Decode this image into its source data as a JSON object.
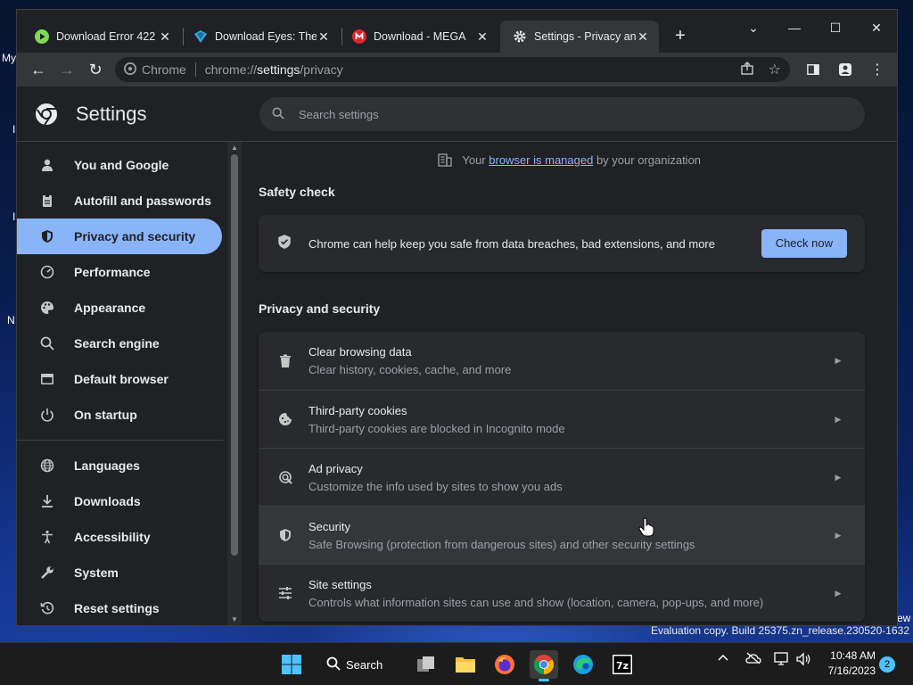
{
  "desktop": {
    "fragments": [
      "My",
      "I",
      "I",
      "N",
      "ew"
    ]
  },
  "tabs": [
    {
      "title": "Download Error 422 -",
      "icon": "play-icon",
      "color": "#7ed957"
    },
    {
      "title": "Download Eyes: The H",
      "icon": "eyes-logo-icon",
      "color": "#2ba8e0"
    },
    {
      "title": "Download - MEGA",
      "icon": "mega-icon",
      "color": "#d9272e"
    },
    {
      "title": "Settings - Privacy and",
      "icon": "gear-icon",
      "color": "#e8eaed"
    }
  ],
  "toolbar": {
    "omnibox_label": "Chrome",
    "url_prefix": "chrome://",
    "url_host": "settings",
    "url_path": "/privacy"
  },
  "settings": {
    "title": "Settings",
    "search_placeholder": "Search settings",
    "nav": [
      {
        "label": "You and Google",
        "icon": "person-icon"
      },
      {
        "label": "Autofill and passwords",
        "icon": "clipboard-icon"
      },
      {
        "label": "Privacy and security",
        "icon": "shield-icon",
        "active": true
      },
      {
        "label": "Performance",
        "icon": "speedometer-icon"
      },
      {
        "label": "Appearance",
        "icon": "palette-icon"
      },
      {
        "label": "Search engine",
        "icon": "search-icon"
      },
      {
        "label": "Default browser",
        "icon": "browser-icon"
      },
      {
        "label": "On startup",
        "icon": "power-icon"
      },
      {
        "label": "Languages",
        "icon": "globe-icon"
      },
      {
        "label": "Downloads",
        "icon": "download-icon"
      },
      {
        "label": "Accessibility",
        "icon": "accessibility-icon"
      },
      {
        "label": "System",
        "icon": "wrench-icon"
      },
      {
        "label": "Reset settings",
        "icon": "reset-icon"
      }
    ],
    "managed": {
      "prefix": "Your",
      "link": "browser is managed",
      "suffix": "by your organization"
    },
    "safety_check": {
      "title": "Safety check",
      "text": "Chrome can help keep you safe from data breaches, bad extensions, and more",
      "button": "Check now"
    },
    "privacy_section": {
      "title": "Privacy and security",
      "rows": [
        {
          "label": "Clear browsing data",
          "sub": "Clear history, cookies, cache, and more",
          "icon": "trash-icon"
        },
        {
          "label": "Third-party cookies",
          "sub": "Third-party cookies are blocked in Incognito mode",
          "icon": "cookie-icon"
        },
        {
          "label": "Ad privacy",
          "sub": "Customize the info used by sites to show you ads",
          "icon": "ad-privacy-icon"
        },
        {
          "label": "Security",
          "sub": "Safe Browsing (protection from dangerous sites) and other security settings",
          "icon": "shield-icon",
          "hover": true
        },
        {
          "label": "Site settings",
          "sub": "Controls what information sites can use and show (location, camera, pop-ups, and more)",
          "icon": "sliders-icon"
        }
      ]
    }
  },
  "taskbar": {
    "search_label": "Search",
    "eval_copy": "Evaluation copy. Build 25375.zn_release.230520-1632",
    "time": "10:48 AM",
    "date": "7/16/2023",
    "notification_count": "2"
  }
}
